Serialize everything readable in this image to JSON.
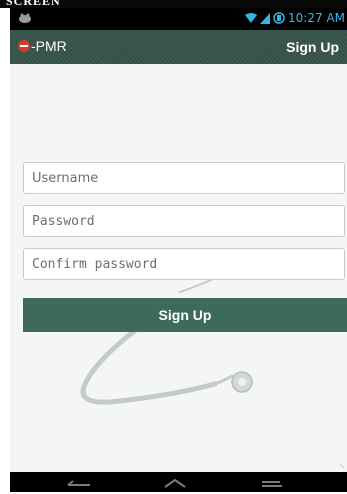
{
  "scan_header": {
    "text": "SCREEN"
  },
  "status_bar": {
    "time": "10:27",
    "time_suffix": "AM",
    "icons": [
      "notification-icon",
      "wifi-icon",
      "signal-icon",
      "battery-icon"
    ],
    "color": "#34b5e5"
  },
  "action_bar": {
    "brand": "-PMR",
    "title": "Sign Up",
    "background": "#36544b",
    "logo_color": "#d63a2a"
  },
  "form": {
    "username_placeholder": "Username",
    "password_placeholder": "Password",
    "confirm_placeholder": "Confirm password",
    "submit_label": "Sign Up",
    "button_color": "#3e6a5d"
  },
  "background": {
    "watermark_icon": "stethoscope-icon"
  },
  "nav_bar": {
    "buttons": [
      "back-icon",
      "home-icon",
      "recent-apps-icon"
    ]
  }
}
